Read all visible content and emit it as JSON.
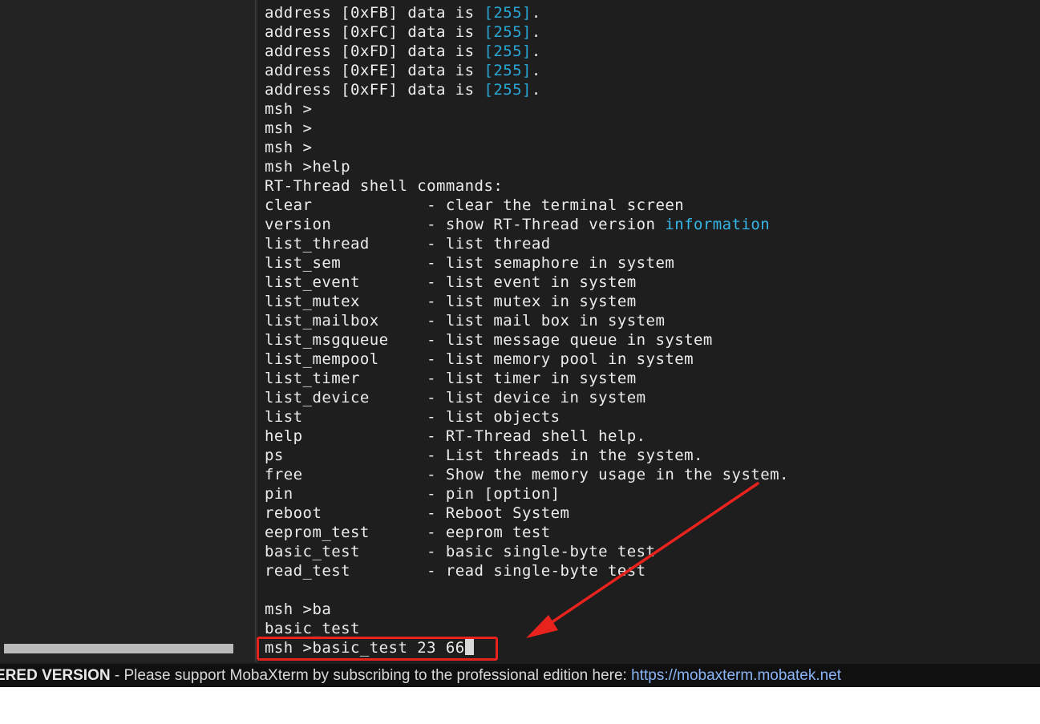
{
  "terminal": {
    "lines": [
      [
        {
          "t": "address [0xFB] data is "
        },
        {
          "t": "[255]",
          "c": "num"
        },
        {
          "t": "."
        }
      ],
      [
        {
          "t": "address [0xFC] data is "
        },
        {
          "t": "[255]",
          "c": "num"
        },
        {
          "t": "."
        }
      ],
      [
        {
          "t": "address [0xFD] data is "
        },
        {
          "t": "[255]",
          "c": "num"
        },
        {
          "t": "."
        }
      ],
      [
        {
          "t": "address [0xFE] data is "
        },
        {
          "t": "[255]",
          "c": "num"
        },
        {
          "t": "."
        }
      ],
      [
        {
          "t": "address [0xFF] data is "
        },
        {
          "t": "[255]",
          "c": "num"
        },
        {
          "t": "."
        }
      ],
      [
        {
          "t": "msh >"
        }
      ],
      [
        {
          "t": "msh >"
        }
      ],
      [
        {
          "t": "msh >"
        }
      ],
      [
        {
          "t": "msh >help"
        }
      ],
      [
        {
          "t": "RT-Thread shell commands:"
        }
      ],
      [
        {
          "t": "clear            - clear the terminal screen"
        }
      ],
      [
        {
          "t": "version          - show RT-Thread version "
        },
        {
          "t": "information",
          "c": "info"
        }
      ],
      [
        {
          "t": "list_thread      - list thread"
        }
      ],
      [
        {
          "t": "list_sem         - list semaphore in system"
        }
      ],
      [
        {
          "t": "list_event       - list event in system"
        }
      ],
      [
        {
          "t": "list_mutex       - list mutex in system"
        }
      ],
      [
        {
          "t": "list_mailbox     - list mail box in system"
        }
      ],
      [
        {
          "t": "list_msgqueue    - list message queue in system"
        }
      ],
      [
        {
          "t": "list_mempool     - list memory pool in system"
        }
      ],
      [
        {
          "t": "list_timer       - list timer in system"
        }
      ],
      [
        {
          "t": "list_device      - list device in system"
        }
      ],
      [
        {
          "t": "list             - list objects"
        }
      ],
      [
        {
          "t": "help             - RT-Thread shell help."
        }
      ],
      [
        {
          "t": "ps               - List threads in the system."
        }
      ],
      [
        {
          "t": "free             - Show the memory usage in the system."
        }
      ],
      [
        {
          "t": "pin              - pin [option]"
        }
      ],
      [
        {
          "t": "reboot           - Reboot System"
        }
      ],
      [
        {
          "t": "eeprom_test      - eeprom test"
        }
      ],
      [
        {
          "t": "basic_test       - basic single-byte test"
        }
      ],
      [
        {
          "t": "read_test        - read single-byte test"
        }
      ],
      [
        {
          "t": ""
        }
      ],
      [
        {
          "t": "msh >ba"
        }
      ],
      [
        {
          "t": "basic_test"
        }
      ]
    ],
    "prompt_line": "msh >basic_test 23 66"
  },
  "status_bar": {
    "unregistered": "ERED VERSION",
    "separator": "  -  ",
    "message": "Please support MobaXterm by subscribing to the professional edition here:  ",
    "link": "https://mobaxterm.mobatek.net"
  },
  "colors": {
    "terminal_bg": "#1e1e1e",
    "terminal_fg": "#ececec",
    "number_highlight": "#2aa7d6",
    "annotation_red": "#e8231d",
    "link": "#8ab4f8"
  }
}
